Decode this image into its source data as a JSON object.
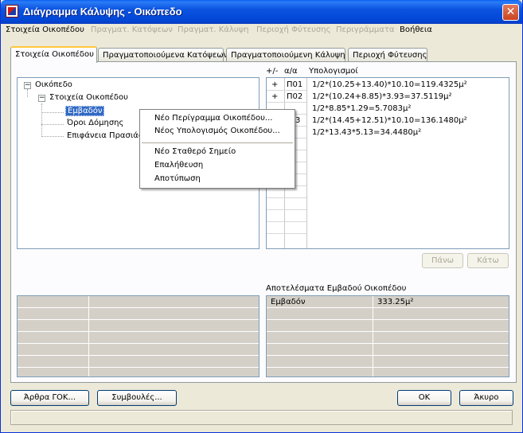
{
  "window": {
    "title": "Διάγραμμα Κάλυψης - Οικόπεδο",
    "close_glyph": "✕"
  },
  "menu": {
    "items": [
      {
        "label": "Στοιχεία Οικοπέδου",
        "enabled": true
      },
      {
        "label": "Πραγματ. Κατόψεων",
        "enabled": false
      },
      {
        "label": "Πραγματ. Κάλυψη",
        "enabled": false
      },
      {
        "label": "Περιοχή Φύτευσης",
        "enabled": false
      },
      {
        "label": "Περιγράμματα",
        "enabled": false
      },
      {
        "label": "Βοήθεια",
        "enabled": true
      }
    ]
  },
  "tabs": [
    {
      "label": "Στοιχεία Οικοπέδου",
      "active": true
    },
    {
      "label": "Πραγματοποιούμενα Κατόψεων",
      "active": false
    },
    {
      "label": "Πραγματοποιούμενη Κάλυψη",
      "active": false
    },
    {
      "label": "Περιοχή Φύτευσης",
      "active": false
    }
  ],
  "tree": {
    "root": "Οικόπεδο",
    "child": "Στοιχεία Οικοπέδου",
    "leaves": [
      "Εμβαδόν",
      "Όροι Δόμησης",
      "Επιφάνεια Πρασιάς"
    ],
    "selected": "Εμβαδόν",
    "expander_glyph": "−"
  },
  "context_menu": {
    "items": [
      "Νέο Περίγραμμα Οικοπέδου...",
      "Νέος Υπολογισμός Οικοπέδου...",
      "Νέο Σταθερό Σημείο",
      "Επαλήθευση",
      "Αποτύπωση"
    ]
  },
  "calc": {
    "headers": {
      "sign": "+/-",
      "id": "α/α",
      "formula": "Υπολογισμοί"
    },
    "rows": [
      {
        "sign": "+",
        "id": "Π01",
        "formula": "1/2*(10.25+13.40)*10.10=119.4325μ²"
      },
      {
        "sign": "+",
        "id": "Π02",
        "formula": "1/2*(10.24+8.85)*3.93=37.5119μ²"
      },
      {
        "sign": "",
        "id": "",
        "formula": "1/2*8.85*1.29=5.7083μ²"
      },
      {
        "sign": "",
        "id": "3",
        "formula": "1/2*(14.45+12.51)*10.10=136.1480μ²"
      },
      {
        "sign": "",
        "id": "",
        "formula": "1/2*13.43*5.13=34.4480μ²"
      }
    ],
    "up_label": "Πάνω",
    "down_label": "Κάτω"
  },
  "results": {
    "label": "Αποτελέσματα Εμβαδού Οικοπέδου",
    "name": "Εμβαδόν",
    "value": "333.25μ²"
  },
  "buttons": {
    "articles": "Άρθρα ΓΟΚ...",
    "advice": "Συμβουλές...",
    "ok": "OK",
    "cancel": "Άκυρο"
  },
  "colors": {
    "titlebar": "#0a5ff0",
    "selection": "#316ac5",
    "active_tab_accent": "#ffc83c",
    "grid_background": "#d4d0c8"
  }
}
